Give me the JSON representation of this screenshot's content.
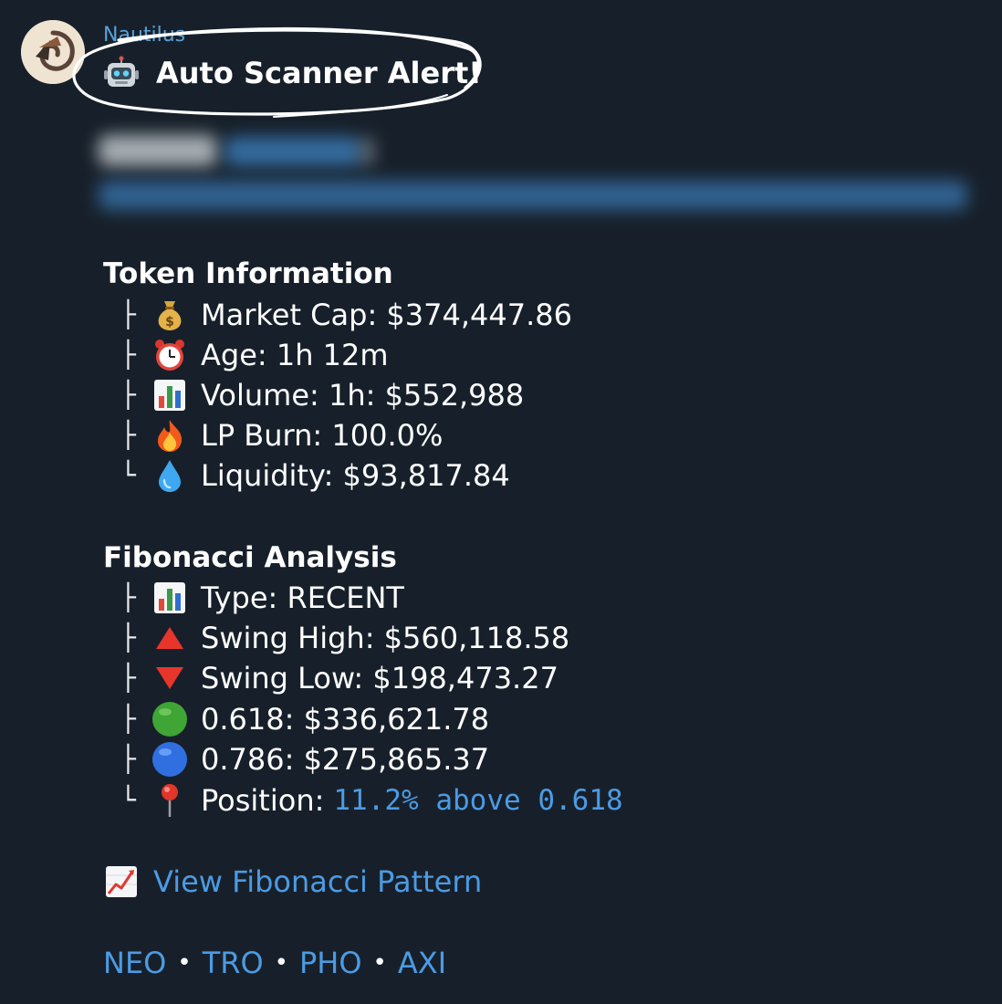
{
  "message": {
    "sender": "Nautilus",
    "title": "Auto Scanner Alert!",
    "title_icon": "robot-icon"
  },
  "token_information": {
    "heading": "Token Information",
    "rows": [
      {
        "branch": "├",
        "icon": "money-bag-icon",
        "text": "Market Cap: $374,447.86"
      },
      {
        "branch": "├",
        "icon": "alarm-clock-icon",
        "text": "Age: 1h 12m"
      },
      {
        "branch": "├",
        "icon": "bar-chart-icon",
        "text": "Volume: 1h: $552,988"
      },
      {
        "branch": "├",
        "icon": "fire-icon",
        "text": "LP Burn: 100.0%"
      },
      {
        "branch": "└",
        "icon": "droplet-icon",
        "text": "Liquidity: $93,817.84"
      }
    ]
  },
  "fibonacci_analysis": {
    "heading": "Fibonacci Analysis",
    "rows": [
      {
        "branch": "├",
        "icon": "bar-chart-icon",
        "text": "Type: RECENT"
      },
      {
        "branch": "├",
        "icon": "red-triangle-up-icon",
        "text": "Swing High: $560,118.58"
      },
      {
        "branch": "├",
        "icon": "red-triangle-down-icon",
        "text": "Swing Low: $198,473.27"
      },
      {
        "branch": "├",
        "icon": "green-circle-icon",
        "text": "0.618: $336,621.78"
      },
      {
        "branch": "├",
        "icon": "blue-circle-icon",
        "text": "0.786: $275,865.37"
      },
      {
        "branch": "└",
        "icon": "pushpin-icon",
        "text": "Position:",
        "value": "11.2% above 0.618"
      }
    ]
  },
  "pattern_link": {
    "icon": "chart-increasing-icon",
    "label": "View Fibonacci Pattern"
  },
  "tags": [
    "NEO",
    "TRO",
    "PHO",
    "AXI"
  ],
  "tag_separator": "•",
  "colors": {
    "background": "#17202a",
    "link": "#4c9be4",
    "sender": "#5aa1d8",
    "text": "#ffffff"
  }
}
